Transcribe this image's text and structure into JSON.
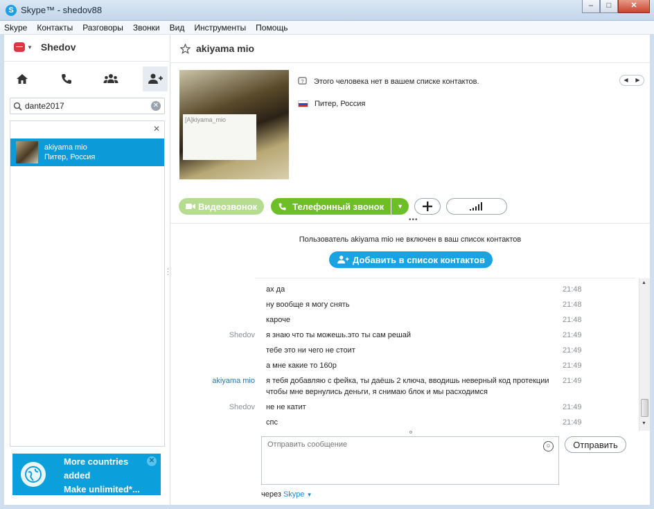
{
  "window": {
    "title": "Skype™ - shedov88"
  },
  "menu": [
    "Skype",
    "Контакты",
    "Разговоры",
    "Звонки",
    "Вид",
    "Инструменты",
    "Помощь"
  ],
  "user": {
    "name": "Shedov"
  },
  "search": {
    "value": "dante2017"
  },
  "results": [
    {
      "name": "akiyama mio",
      "location": "Питер, Россия"
    }
  ],
  "promo": {
    "line1": "More countries",
    "line2": "added",
    "line3": "Make unlimited*..."
  },
  "conversation": {
    "contact_name": "akiyama mio",
    "photo_note": "[A]kiyama_mio",
    "not_in_contacts": "Этого человека нет в вашем списке контактов.",
    "location": "Питер, Россия",
    "video_call": "Видеозвонок",
    "phone_call": "Телефонный звонок",
    "notice": "Пользователь akiyama mio не включен в ваш список контактов",
    "add_contact": "Добавить в список контактов"
  },
  "messages": [
    {
      "sender": "",
      "text": "ах да",
      "time": "21:48"
    },
    {
      "sender": "",
      "text": "ну вообще я могу снять",
      "time": "21:48"
    },
    {
      "sender": "",
      "text": "кароче",
      "time": "21:48"
    },
    {
      "sender": "Shedov",
      "text": "я знаю что ты можешь.это ты сам решай",
      "time": "21:49"
    },
    {
      "sender": "",
      "text": "тебе это ни чего не стоит",
      "time": "21:49"
    },
    {
      "sender": "",
      "text": "а мне какие то 160р",
      "time": "21:49"
    },
    {
      "sender": "akiyama mio",
      "text": "я тебя добавляю с фейка, ты даёшь 2 ключа, вводишь неверный код протекции чтобы мне вернулись деньги, я снимаю блок и мы расходимся",
      "time": "21:49"
    },
    {
      "sender": "Shedov",
      "text": "не не катит",
      "time": "21:49"
    },
    {
      "sender": "",
      "text": "спс",
      "time": "21:49"
    }
  ],
  "compose": {
    "placeholder": "Отправить сообщение",
    "send": "Отправить",
    "via_prefix": "через",
    "via_service": "Skype"
  },
  "colors": {
    "accent": "#0d9ad9",
    "call_green": "#6ebe26",
    "promo_bg": "#0ba0dc"
  }
}
